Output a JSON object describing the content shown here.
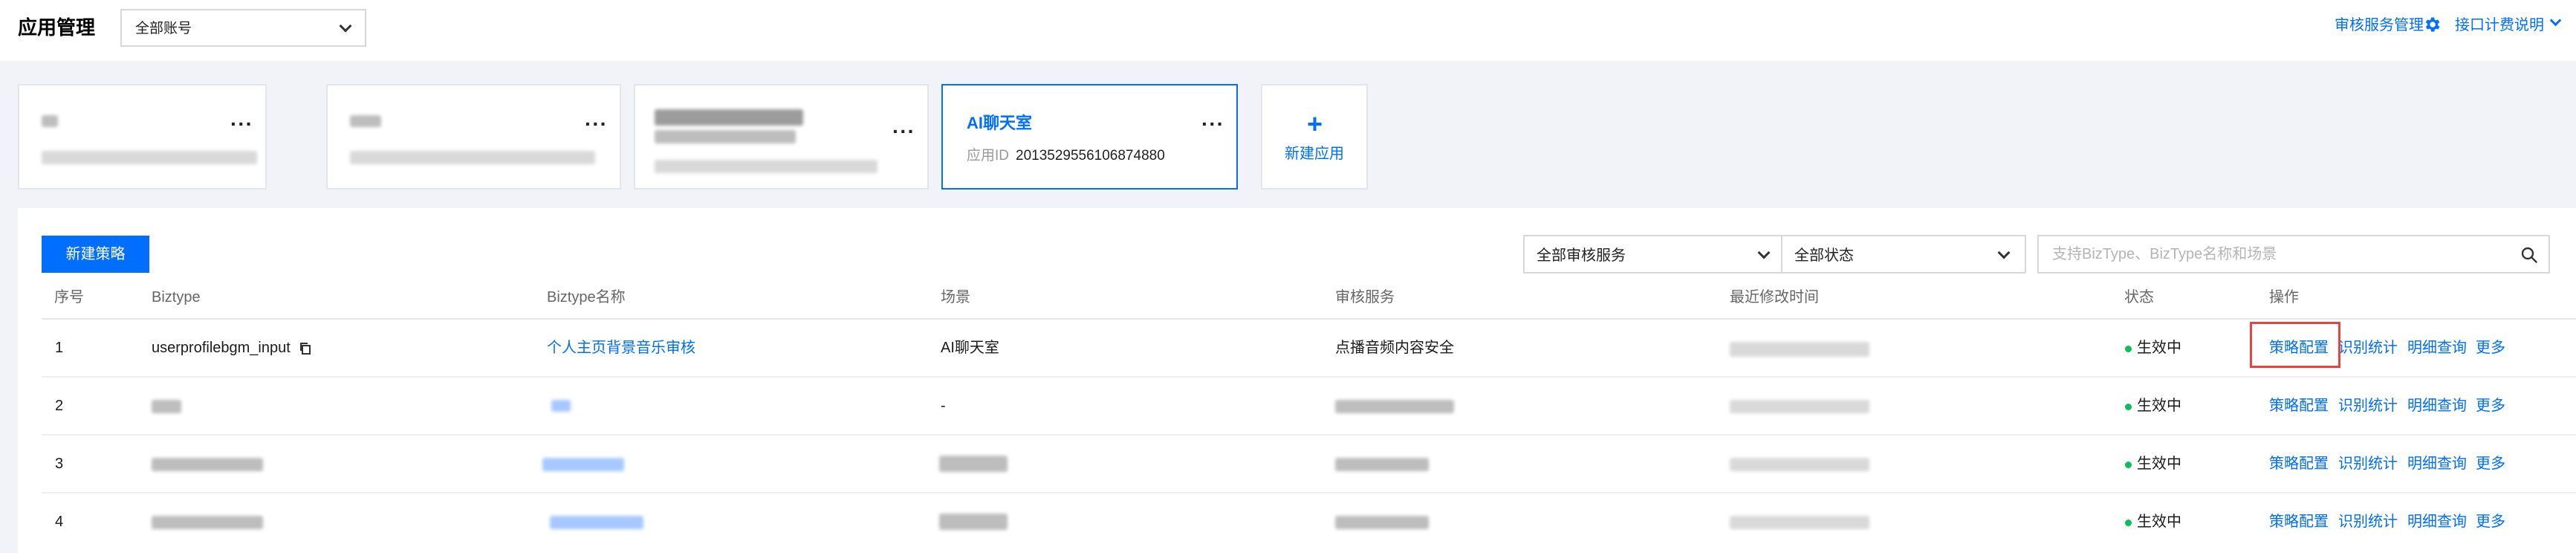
{
  "header": {
    "title": "应用管理",
    "account_select": "全部账号",
    "review_service_link": "审核服务管理",
    "billing_link": "接口计费说明"
  },
  "apps": {
    "active": {
      "name": "AI聊天室",
      "id_label": "应用ID",
      "id_value": "2013529556106874880"
    },
    "new_app_label": "新建应用"
  },
  "toolbar": {
    "new_strategy": "新建策略",
    "service_filter": "全部审核服务",
    "status_filter": "全部状态",
    "search_placeholder": "支持BizType、BizType名称和场景"
  },
  "table": {
    "columns": [
      "序号",
      "Biztype",
      "Biztype名称",
      "场景",
      "审核服务",
      "最近修改时间",
      "状态",
      "操作"
    ],
    "rows": [
      {
        "index": "1",
        "biztype": "userprofilebgm_input",
        "name": "个人主页背景音乐审核",
        "scene": "AI聊天室",
        "service": "点播音频内容安全",
        "status": "生效中"
      },
      {
        "index": "2",
        "biztype": "",
        "name": "",
        "scene": "-",
        "service": "",
        "status": "生效中"
      },
      {
        "index": "3",
        "biztype": "",
        "name": "",
        "scene": "",
        "service": "",
        "status": "生效中"
      },
      {
        "index": "4",
        "biztype": "",
        "name": "",
        "scene": "",
        "service": "",
        "status": "生效中"
      }
    ],
    "actions": [
      "策略配置",
      "识别统计",
      "明细查询",
      "更多"
    ]
  },
  "icons": [
    "gear-icon",
    "chevron-down-icon",
    "copy-icon",
    "search-icon",
    "plus-icon",
    "more-icon"
  ],
  "colors": {
    "accent": "#006eff",
    "active_status": "#0abf5b",
    "highlight": "#e54545"
  }
}
